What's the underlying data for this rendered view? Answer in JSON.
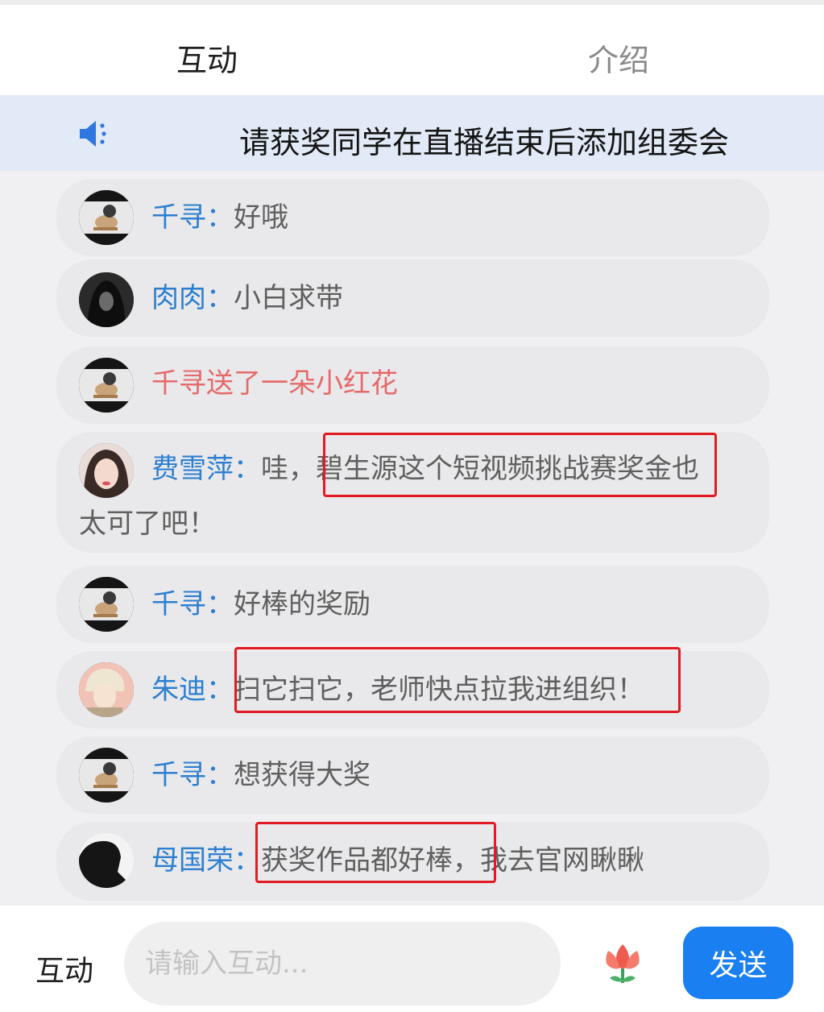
{
  "tabs": {
    "interact": "互动",
    "intro": "介绍"
  },
  "notice": {
    "icon": "speaker-icon",
    "text": "请获奖同学在直播结束后添加组委会"
  },
  "messages": [
    {
      "name": "千寻：",
      "text": "好哦",
      "avatar": "penguin-avatar"
    },
    {
      "name": "肉肉：",
      "text": "小白求带",
      "avatar": "dark-hair-avatar"
    },
    {
      "gift": "千寻送了一朵小红花",
      "avatar": "penguin-avatar"
    },
    {
      "name": "费雪萍：",
      "text": "哇，",
      "text_hl": "碧生源这个短视频挑战赛奖金",
      "text_after": "也",
      "text_line2": "太可了吧！",
      "avatar": "girl-avatar"
    },
    {
      "name": "千寻：",
      "text": "好棒的奖励",
      "avatar": "penguin-avatar"
    },
    {
      "name": "朱迪：",
      "text_hl": "扫它扫它，老师快点拉我进组织！",
      "avatar": "anime-boy-avatar"
    },
    {
      "name": "千寻：",
      "text": "想获得大奖",
      "avatar": "penguin-avatar"
    },
    {
      "name": "母国荣：",
      "text_hl": "获奖作品都好棒，",
      "text_after": "我去官网瞅瞅",
      "avatar": "silhouette-avatar"
    }
  ],
  "bottom_bar": {
    "label": "互动",
    "input_placeholder": "请输入互动...",
    "flower_icon": "flower-icon",
    "send_label": "发送"
  },
  "colors": {
    "name_blue": "#2d7fd0",
    "gift_red": "#e56a6a",
    "highlight_red": "#e21b23",
    "send_blue": "#1a7ff0",
    "notice_bg": "#e3eaf7"
  }
}
